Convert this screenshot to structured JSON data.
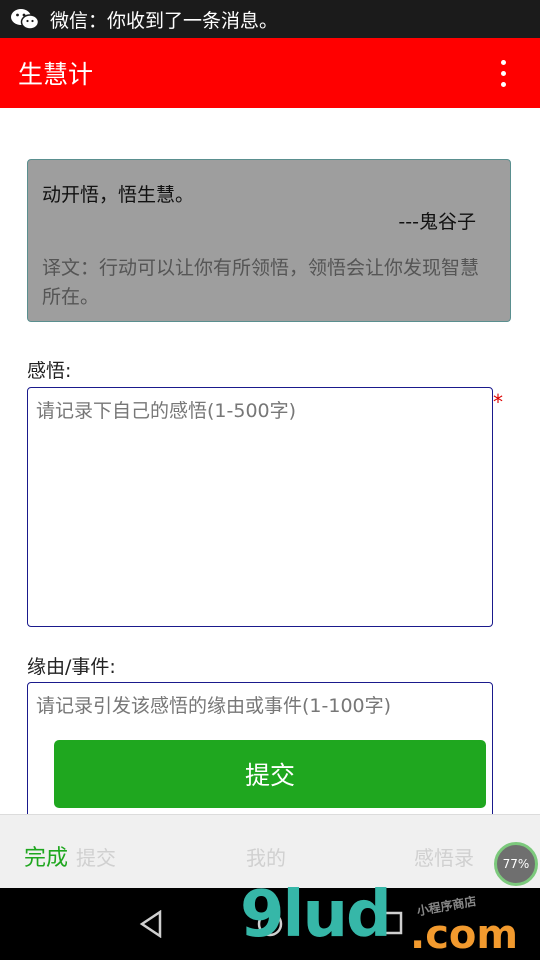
{
  "status_bar": {
    "notification_text": "微信：你收到了一条消息。"
  },
  "app_bar": {
    "title": "生慧计"
  },
  "quote_card": {
    "quote": "动开悟，悟生慧。",
    "author": "---鬼谷子",
    "translation": "译文：行动可以让你有所领悟，领悟会让你发现智慧所在。"
  },
  "form": {
    "insight_label": "感悟:",
    "insight_placeholder": "请记录下自己的感悟(1-500字)",
    "required_mark": "*",
    "reason_label": "缘由/事件:",
    "reason_placeholder": "请记录引发该感悟的缘由或事件(1-100字)",
    "submit_label": "提交"
  },
  "keyboard_accessory": {
    "done_label": "完成",
    "ghost_tabs": [
      "提交",
      "我的",
      "感悟录"
    ],
    "progress_text": "77%"
  },
  "watermark": {
    "logo_text": "9lud",
    "domain_text": ".com",
    "tagline": "小程序商店"
  },
  "colors": {
    "app_bar": "#ff0000",
    "accent_green": "#1fa71f",
    "textarea_border": "#1a1a8c"
  }
}
